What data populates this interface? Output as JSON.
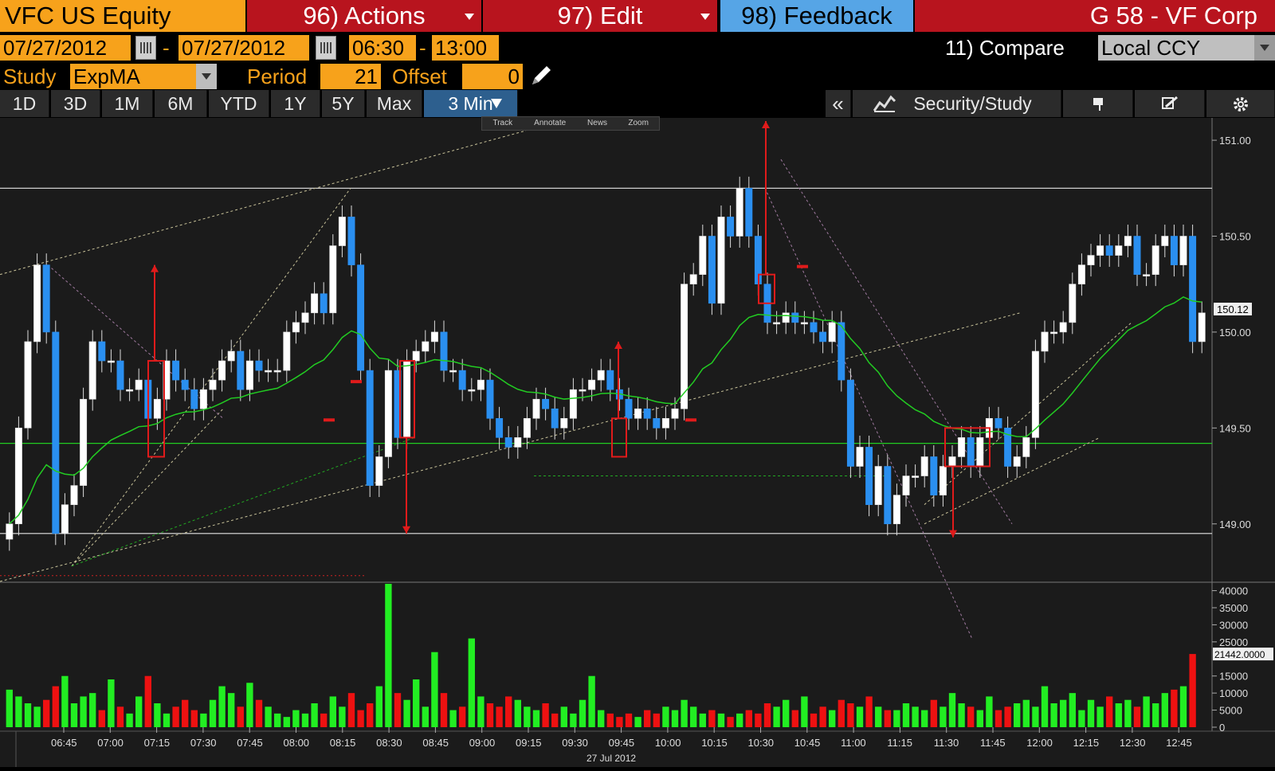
{
  "header": {
    "ticker": "VFC US Equity",
    "actions": "96) Actions",
    "edit": "97) Edit",
    "feedback": "98) Feedback",
    "page_title": "G 58 - VF Corp"
  },
  "range": {
    "start_date": "07/27/2012",
    "separator": "-",
    "end_date": "07/27/2012",
    "start_time": "06:30",
    "time_sep": "-",
    "end_time": "13:00",
    "compare": "11) Compare",
    "currency": "Local CCY"
  },
  "study": {
    "label": "Study",
    "value": "ExpMA",
    "period_label": "Period",
    "period": "21",
    "offset_label": "Offset",
    "offset": "0"
  },
  "periods": [
    "1D",
    "3D",
    "1M",
    "6M",
    "YTD",
    "1Y",
    "5Y",
    "Max"
  ],
  "active_period": "3 Min",
  "toolbar": {
    "collapse": "«",
    "security_study": "Security/Study",
    "mini": [
      "Track",
      "Annotate",
      "News",
      "Zoom"
    ]
  },
  "chart_data": {
    "type": "candlestick",
    "price_axis": {
      "ticks": [
        "151.00",
        "150.50",
        "150.00",
        "149.50",
        "149.00"
      ],
      "range": [
        148.7,
        151.1
      ]
    },
    "last_price": "150.12",
    "volume_axis": {
      "ticks": [
        "40000",
        "35000",
        "30000",
        "25000",
        "15000",
        "10000",
        "5000",
        "0"
      ],
      "range": [
        0,
        42000
      ]
    },
    "last_volume": "21442.0000",
    "time_labels": [
      "06:45",
      "07:00",
      "07:15",
      "07:30",
      "07:45",
      "08:00",
      "08:15",
      "08:30",
      "08:45",
      "09:00",
      "09:15",
      "09:30",
      "09:45",
      "10:00",
      "10:15",
      "10:30",
      "10:45",
      "11:00",
      "11:15",
      "11:30",
      "11:45",
      "12:00",
      "12:15",
      "12:30",
      "12:45"
    ],
    "date_label": "27 Jul 2012",
    "colors": {
      "up": "#ffffff",
      "down": "#2a8ff0",
      "ema": "#22cc22",
      "vol_up": "#22ee22",
      "vol_down": "#ee1111",
      "marker": "#e01b1b"
    },
    "close": [
      149.0,
      149.5,
      149.95,
      150.35,
      150.0,
      148.95,
      149.1,
      149.2,
      149.65,
      149.95,
      149.85,
      149.85,
      149.7,
      149.7,
      149.75,
      149.55,
      149.65,
      149.85,
      149.75,
      149.7,
      149.6,
      149.7,
      149.75,
      149.85,
      149.9,
      149.7,
      149.85,
      149.8,
      149.8,
      149.8,
      150.0,
      150.05,
      150.1,
      150.2,
      150.1,
      150.45,
      150.6,
      150.35,
      149.8,
      149.2,
      149.35,
      149.8,
      149.45,
      149.85,
      149.9,
      149.95,
      150.0,
      149.8,
      149.8,
      149.7,
      149.7,
      149.75,
      149.55,
      149.45,
      149.4,
      149.45,
      149.55,
      149.65,
      149.6,
      149.5,
      149.55,
      149.7,
      149.7,
      149.75,
      149.8,
      149.7,
      149.65,
      149.55,
      149.6,
      149.55,
      149.5,
      149.55,
      149.6,
      150.25,
      150.3,
      150.5,
      150.15,
      150.6,
      150.5,
      150.75,
      150.5,
      150.25,
      150.05,
      150.05,
      150.1,
      150.05,
      150.05,
      150.0,
      149.95,
      150.05,
      149.75,
      149.3,
      149.4,
      149.1,
      149.3,
      149.0,
      149.15,
      149.25,
      149.25,
      149.35,
      149.15,
      149.3,
      149.35,
      149.45,
      149.3,
      149.45,
      149.55,
      149.5,
      149.3,
      149.35,
      149.45,
      149.9,
      150.0,
      150.0,
      150.05,
      150.25,
      150.35,
      150.4,
      150.45,
      150.4,
      150.45,
      150.5,
      150.3,
      150.3,
      150.45,
      150.5,
      150.35,
      150.5,
      149.95,
      150.1
    ],
    "volume": [
      11000,
      9000,
      7000,
      6000,
      8000,
      12000,
      15000,
      7000,
      9000,
      10000,
      5000,
      14000,
      6000,
      4000,
      9000,
      15000,
      7000,
      4000,
      6000,
      8000,
      5000,
      4000,
      8000,
      12000,
      10000,
      6000,
      13000,
      8000,
      6000,
      4000,
      3000,
      5000,
      4000,
      7000,
      4000,
      9000,
      6000,
      10000,
      5000,
      7000,
      12000,
      42000,
      10000,
      8000,
      14000,
      6000,
      22000,
      10000,
      5000,
      6000,
      26000,
      9000,
      7000,
      6000,
      9000,
      8000,
      6000,
      5000,
      7000,
      4000,
      6000,
      4000,
      8000,
      15000,
      5000,
      4000,
      3000,
      4000,
      3000,
      5000,
      4000,
      6000,
      5000,
      8000,
      6000,
      4000,
      5000,
      4000,
      3000,
      4000,
      5000,
      4000,
      7000,
      6000,
      8000,
      5000,
      9000,
      4000,
      6000,
      5000,
      8000,
      7000,
      6000,
      9000,
      6000,
      5000,
      5000,
      7000,
      6000,
      5000,
      8000,
      6000,
      10000,
      7000,
      6000,
      5000,
      9000,
      5000,
      6000,
      7000,
      8000,
      6000,
      12000,
      7000,
      8000,
      10000,
      5000,
      8000,
      6000,
      9000,
      7000,
      8000,
      6000,
      9000,
      7000,
      10000,
      11000,
      12000,
      21442
    ]
  }
}
